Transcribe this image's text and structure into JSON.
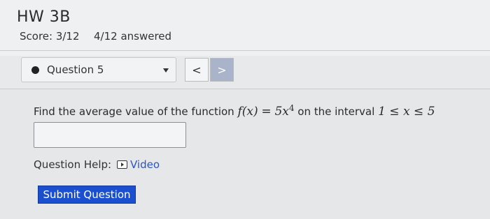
{
  "header": {
    "title": "HW 3B",
    "score": "Score: 3/12",
    "answered": "4/12 answered"
  },
  "question_nav": {
    "selected": "Question 5",
    "prev_symbol": "<",
    "next_symbol": ">"
  },
  "problem": {
    "prefix": "Find the average value of the function",
    "function_lhs": "f(x)",
    "equals": "=",
    "function_rhs": "5x",
    "exponent": "4",
    "mid_text": "on the interval",
    "interval": "1 ≤ x ≤ 5"
  },
  "answer": {
    "value": ""
  },
  "help": {
    "label": "Question Help:",
    "video_label": "Video"
  },
  "actions": {
    "submit_label": "Submit Question"
  },
  "colors": {
    "submit_bg": "#1a4fd0",
    "link": "#2a55c4",
    "next_button": "#a9b4ca"
  },
  "icons": [
    "video-icon",
    "dropdown-caret-icon",
    "bullet-icon"
  ]
}
